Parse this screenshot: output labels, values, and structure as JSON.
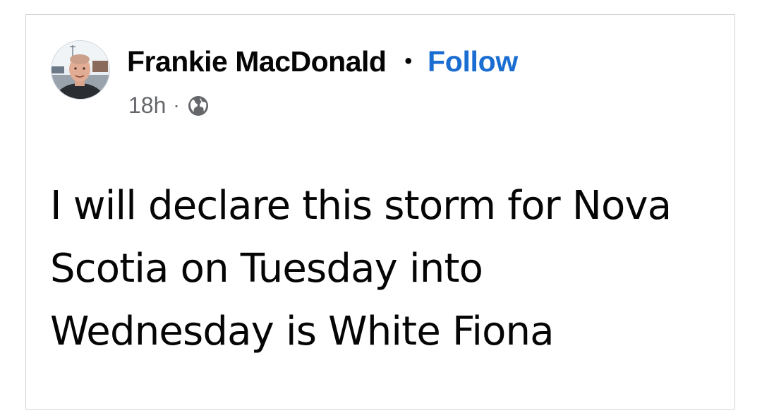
{
  "post": {
    "author": {
      "name": "Frankie MacDonald",
      "avatar_icon": "profile-photo"
    },
    "separator": "•",
    "follow_label": "Follow",
    "timestamp": "18h",
    "meta_separator": "·",
    "audience_icon": "globe-icon",
    "text": "I will declare this storm for Nova Scotia on Tuesday into Wednesday is White Fiona"
  },
  "colors": {
    "follow": "#1a6dd1",
    "text": "#050505",
    "meta": "#65676b",
    "border": "#d4d4d4"
  }
}
